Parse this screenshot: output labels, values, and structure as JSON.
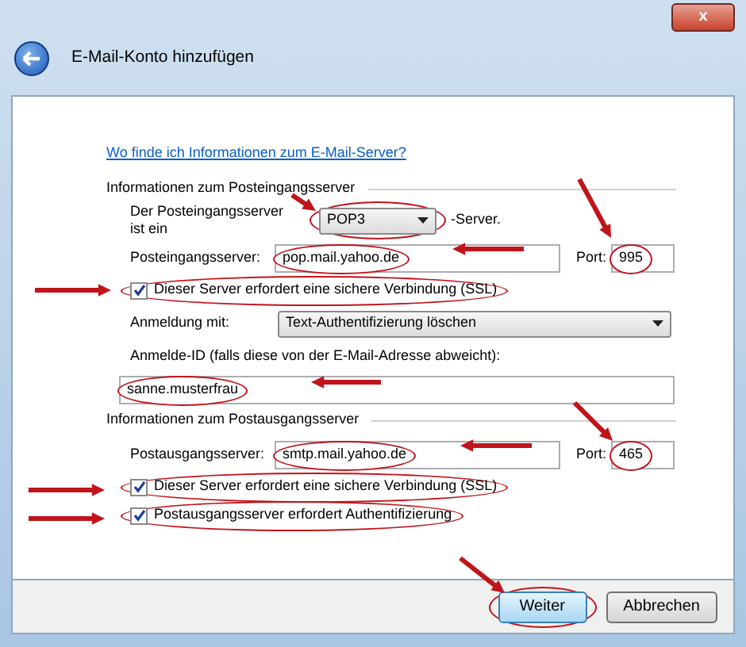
{
  "window": {
    "title": "E-Mail-Konto hinzufügen",
    "close": "x"
  },
  "help_link": "Wo finde ich Informationen zum E-Mail-Server?",
  "incoming": {
    "heading": "Informationen zum Posteingangsserver",
    "type_label": "Der Posteingangsserver ist ein",
    "type_value": "POP3",
    "type_suffix": "-Server.",
    "server_label": "Posteingangsserver:",
    "server_value": "pop.mail.yahoo.de",
    "port_label": "Port:",
    "port_value": "995",
    "ssl": {
      "label": "Dieser Server erfordert eine sichere Verbindung (SSL)",
      "checked": true
    },
    "auth_label": "Anmeldung mit:",
    "auth_value": "Text-Authentifizierung löschen",
    "login_label": "Anmelde-ID (falls diese von der E-Mail-Adresse abweicht):",
    "login_value": "sanne.musterfrau"
  },
  "outgoing": {
    "heading": "Informationen zum Postausgangsserver",
    "server_label": "Postausgangsserver:",
    "server_value": "smtp.mail.yahoo.de",
    "port_label": "Port:",
    "port_value": "465",
    "checks": [
      {
        "label": "Dieser Server erfordert eine sichere Verbindung (SSL)",
        "checked": true
      },
      {
        "label": "Postausgangsserver erfordert Authentifizierung",
        "checked": true
      }
    ]
  },
  "buttons": [
    {
      "label": "Weiter",
      "selected": true
    },
    {
      "label": "Abbrechen",
      "selected": false
    }
  ]
}
